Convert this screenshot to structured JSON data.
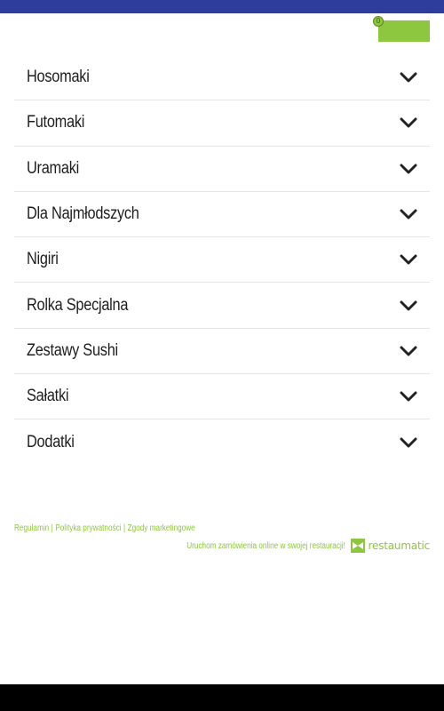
{
  "header": {
    "bar_color": "#2e3c9c",
    "cart": {
      "count": "0",
      "color": "#8dc63f"
    }
  },
  "menu": {
    "items": [
      {
        "label": "Hosomaki"
      },
      {
        "label": "Futomaki"
      },
      {
        "label": "Uramaki"
      },
      {
        "label": "Dla Najmłodszych"
      },
      {
        "label": "Nigiri"
      },
      {
        "label": "Rolka Specjalna"
      },
      {
        "label": "Zestawy Sushi"
      },
      {
        "label": "Sałatki"
      },
      {
        "label": "Dodatki"
      }
    ],
    "expand_icon": "chevron-down-icon"
  },
  "footer": {
    "links": [
      {
        "label": "Regulamin"
      },
      {
        "label": "Polityka prywatności"
      },
      {
        "label": "Zgody marketingowe"
      }
    ],
    "separator": "|",
    "promo_text": "Uruchom zamówienia online w swojej restauracji!",
    "brand": "restaumatic",
    "accent_color": "#8dc63f"
  },
  "system": {
    "nav_bar_color": "#000000"
  }
}
